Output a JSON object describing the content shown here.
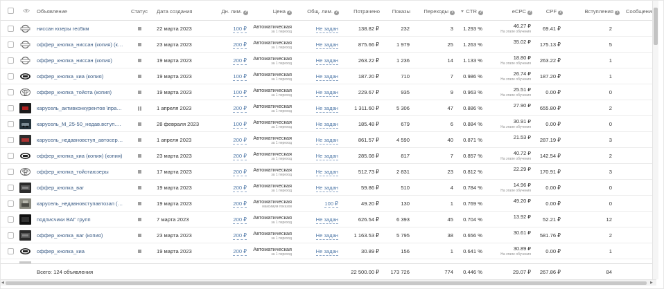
{
  "columns": {
    "ad": "Объявление",
    "status": "Статус",
    "created": "Дата создания",
    "daily_limit": "Дн. лим.",
    "price": "Цена",
    "total_limit": "Общ. лим.",
    "spent": "Потрачено",
    "impressions": "Показы",
    "clicks": "Переходы",
    "ctr": "CTR",
    "ecpc": "eCPC",
    "cpf": "CPF",
    "joins": "Вступления",
    "messages": "Сообщения"
  },
  "rows": [
    {
      "name": "ниссан юзеры гео5км",
      "thumb": "nissan",
      "status": "stopped",
      "date": "22 марта 2023",
      "daily": "100 ₽",
      "bid": "Автоматическая",
      "bid_sub": "за 1 переход",
      "total": "Не задан",
      "spent": "138.82 ₽",
      "impressions": "232",
      "clicks": "3",
      "ctr": "1.293 %",
      "ecpc": "46.27 ₽",
      "ecpc_sub": "На этапе обучения",
      "cpf": "69.41 ₽",
      "joins": "2"
    },
    {
      "name": "оффер_кнопка_ниссан (копия) (коп...",
      "thumb": "nissan",
      "status": "stopped",
      "date": "23 марта 2023",
      "daily": "200 ₽",
      "bid": "Автоматическая",
      "bid_sub": "за 1 переход",
      "total": "Не задан",
      "spent": "875.66 ₽",
      "impressions": "1 979",
      "clicks": "25",
      "ctr": "1.263 %",
      "ecpc": "35.02 ₽",
      "ecpc_sub": "",
      "cpf": "175.13 ₽",
      "joins": "5"
    },
    {
      "name": "оффер_кнопка_ниссан (копия)",
      "thumb": "nissan",
      "status": "stopped",
      "date": "19 марта 2023",
      "daily": "200 ₽",
      "bid": "Автоматическая",
      "bid_sub": "за 1 переход",
      "total": "Не задан",
      "spent": "263.22 ₽",
      "impressions": "1 236",
      "clicks": "14",
      "ctr": "1.133 %",
      "ecpc": "18.80 ₽",
      "ecpc_sub": "На этапе обучения",
      "cpf": "263.22 ₽",
      "joins": "1"
    },
    {
      "name": "оффер_кнопка_киа (копия)",
      "thumb": "kia",
      "status": "stopped",
      "date": "19 марта 2023",
      "daily": "100 ₽",
      "bid": "Автоматическая",
      "bid_sub": "за 1 переход",
      "total": "Не задан",
      "spent": "187.20 ₽",
      "impressions": "710",
      "clicks": "7",
      "ctr": "0.986 %",
      "ecpc": "26.74 ₽",
      "ecpc_sub": "На этапе обучения",
      "cpf": "187.20 ₽",
      "joins": "1"
    },
    {
      "name": "оффер_кнопка_тойота (копия)",
      "thumb": "toyota",
      "status": "stopped",
      "date": "19 марта 2023",
      "daily": "100 ₽",
      "bid": "Автоматическая",
      "bid_sub": "за 1 переход",
      "total": "Не задан",
      "spent": "229.67 ₽",
      "impressions": "935",
      "clicks": "9",
      "ctr": "0.963 %",
      "ecpc": "25.51 ₽",
      "ecpc_sub": "На этапе обучения",
      "cpf": "0.00 ₽",
      "joins": "0"
    },
    {
      "name": "карусель_активконкурентов \\правки",
      "thumb": "dark",
      "status": "paused",
      "date": "1 апреля 2023",
      "daily": "200 ₽",
      "bid": "Автоматическая",
      "bid_sub": "за 1 переход",
      "total": "Не задан",
      "spent": "1 311.60 ₽",
      "impressions": "5 306",
      "clicks": "47",
      "ctr": "0.886 %",
      "ecpc": "27.90 ₽",
      "ecpc_sub": "",
      "cpf": "655.80 ₽",
      "joins": "2"
    },
    {
      "name": "карусель_М_25-50_недав.вступ.авт...",
      "thumb": "car",
      "status": "stopped",
      "date": "28 февраля 2023",
      "daily": "100 ₽",
      "bid": "Автоматическая",
      "bid_sub": "за 1 переход",
      "total": "Не задан",
      "spent": "185.48 ₽",
      "impressions": "679",
      "clicks": "6",
      "ctr": "0.884 %",
      "ecpc": "30.91 ₽",
      "ecpc_sub": "На этапе обучения",
      "cpf": "0.00 ₽",
      "joins": "0"
    },
    {
      "name": "карусель_недавновступ_автосерви...",
      "thumb": "car2",
      "status": "stopped",
      "date": "1 апреля 2023",
      "daily": "200 ₽",
      "bid": "Автоматическая",
      "bid_sub": "за 1 переход",
      "total": "Не задан",
      "spent": "861.57 ₽",
      "impressions": "4 590",
      "clicks": "40",
      "ctr": "0.871 %",
      "ecpc": "21.53 ₽",
      "ecpc_sub": "",
      "cpf": "287.19 ₽",
      "joins": "3"
    },
    {
      "name": "оффер_кнопка_киа (копия) (копия)",
      "thumb": "kia",
      "status": "stopped",
      "date": "23 марта 2023",
      "daily": "200 ₽",
      "bid": "Автоматическая",
      "bid_sub": "за 1 переход",
      "total": "Не задан",
      "spent": "285.08 ₽",
      "impressions": "817",
      "clicks": "7",
      "ctr": "0.857 %",
      "ecpc": "40.72 ₽",
      "ecpc_sub": "На этапе обучения",
      "cpf": "142.54 ₽",
      "joins": "2"
    },
    {
      "name": "оффер_кнопка_тойотаюзеры",
      "thumb": "toyota",
      "status": "stopped",
      "date": "17 марта 2023",
      "daily": "200 ₽",
      "bid": "Автоматическая",
      "bid_sub": "за 1 переход",
      "total": "Не задан",
      "spent": "512.73 ₽",
      "impressions": "2 831",
      "clicks": "23",
      "ctr": "0.812 %",
      "ecpc": "22.29 ₽",
      "ecpc_sub": "",
      "cpf": "170.91 ₽",
      "joins": "3"
    },
    {
      "name": "оффер_кнопка_ваг",
      "thumb": "dark2",
      "status": "stopped",
      "date": "19 марта 2023",
      "daily": "200 ₽",
      "bid": "Автоматическая",
      "bid_sub": "за 1 переход",
      "total": "Не задан",
      "spent": "59.86 ₽",
      "impressions": "510",
      "clicks": "4",
      "ctr": "0.784 %",
      "ecpc": "14.96 ₽",
      "ecpc_sub": "На этапе обучения",
      "cpf": "0.00 ₽",
      "joins": "0"
    },
    {
      "name": "карусель_недавновступавтозап (коп...",
      "thumb": "photo",
      "status": "stopped",
      "date": "19 марта 2023",
      "daily": "200 ₽",
      "bid": "Автоматическая",
      "bid_sub": "максимум показов",
      "total": "100 ₽",
      "spent": "49.20 ₽",
      "impressions": "130",
      "clicks": "1",
      "ctr": "0.769 %",
      "ecpc": "49.20 ₽",
      "ecpc_sub": "",
      "cpf": "0.00 ₽",
      "joins": "0"
    },
    {
      "name": "подписчики ВАГ групп",
      "thumb": "dark3",
      "status": "stopped",
      "date": "7 марта 2023",
      "daily": "200 ₽",
      "bid": "Автоматическая",
      "bid_sub": "за 1 переход",
      "total": "Не задан",
      "spent": "626.54 ₽",
      "impressions": "6 393",
      "clicks": "45",
      "ctr": "0.704 %",
      "ecpc": "13.92 ₽",
      "ecpc_sub": "",
      "cpf": "52.21 ₽",
      "joins": "12"
    },
    {
      "name": "оффер_кнопка_ваг (копия)",
      "thumb": "dark2",
      "status": "stopped",
      "date": "23 марта 2023",
      "daily": "200 ₽",
      "bid": "Автоматическая",
      "bid_sub": "за 1 переход",
      "total": "Не задан",
      "spent": "1 163.53 ₽",
      "impressions": "5 795",
      "clicks": "38",
      "ctr": "0.656 %",
      "ecpc": "30.61 ₽",
      "ecpc_sub": "",
      "cpf": "581.76 ₽",
      "joins": "2"
    },
    {
      "name": "оффер_кнопка_киа",
      "thumb": "kia",
      "status": "stopped",
      "date": "19 марта 2023",
      "daily": "200 ₽",
      "bid": "Автоматическая",
      "bid_sub": "за 1 переход",
      "total": "Не задан",
      "spent": "30.89 ₽",
      "impressions": "156",
      "clicks": "1",
      "ctr": "0.641 %",
      "ecpc": "30.89 ₽",
      "ecpc_sub": "На этапе обучения",
      "cpf": "0.00 ₽",
      "joins": "1"
    }
  ],
  "footer": {
    "total_label": "Всего: 124 объявления",
    "spent": "22 500.00 ₽",
    "impressions": "173 726",
    "clicks": "774",
    "ctr": "0.446 %",
    "ecpc": "29.07 ₽",
    "cpf": "267.86 ₽",
    "joins": "84"
  },
  "colors": {
    "link": "#3c5d86",
    "dashed": "#5079a8",
    "status": "#9e9e9e"
  }
}
